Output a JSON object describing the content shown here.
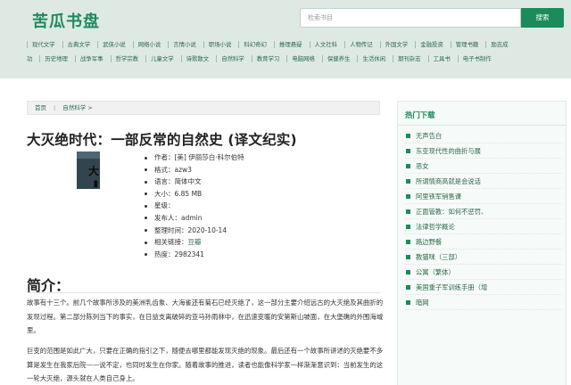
{
  "site": {
    "logo": "苦瓜书盘"
  },
  "search": {
    "placeholder": "检索书目",
    "button": "搜索"
  },
  "nav": {
    "row1": [
      "现代文学",
      "古典文学",
      "武侠小说",
      "网络小说",
      "言情小说",
      "职场小说",
      "科幻奇幻",
      "推理悬疑",
      "人文社科",
      "人物传记",
      "外国文学",
      "金融投资",
      "管理书籍",
      "励志成"
    ],
    "row2": [
      "功",
      "历史地理",
      "战争军事",
      "哲学宗教",
      "儿童文学",
      "诗歌散文",
      "自然科学",
      "教育学习",
      "电脑网络",
      "保健养生",
      "生活休闲",
      "期刊杂志",
      "工具书",
      "电子书制作"
    ]
  },
  "breadcrumb": {
    "home": "首页",
    "category": "自然科学",
    "separator": ">"
  },
  "book": {
    "title": "大灭绝时代：一部反常的自然史 (译文纪实)",
    "cover_colors": {
      "bg": "#32454f"
    },
    "cover_text": "大",
    "meta": [
      {
        "label": "作者：",
        "value": "[美] 伊丽莎白·科尔伯特"
      },
      {
        "label": "格式：",
        "value": "azw3"
      },
      {
        "label": "语言：",
        "value": "简体中文"
      },
      {
        "label": "大小：",
        "value": "6.85 MB"
      },
      {
        "label": "星级：",
        "value": ""
      },
      {
        "label": "发布人：",
        "value": "admin"
      },
      {
        "label": "整理时间：",
        "value": "2020-10-14"
      },
      {
        "label": "相关链接：",
        "value": "豆瓣"
      },
      {
        "label": "热度：",
        "value": "2982341"
      }
    ]
  },
  "intro": {
    "heading": "简介：",
    "p1": "故事有十三个。前几个故事所涉及的美洲乳齿象、大海雀还有菊石已经灭绝了，这一部分主要介绍远古的大灭绝及其曲折的发现过程。第二部分陈列当下的事实，在日益支离破碎的亚马孙雨林中，在迅速变暖的安第斯山坡面，在大堡礁的外围海域里。",
    "p2": "巨变的范围是如此广大，只要在正确的指引之下，随便去哪里都能发现灭绝的现象。最后还有一个故事所讲述的灭绝要不多算是发生在我家后院——说不定，也同时发生在你家。随着故事的推进，读者也能像科学家一样渐渐意识到：当前发生的这一轮大灭绝，源头就在人类自己身上。"
  },
  "sidebar": {
    "title": "热门下载",
    "items": [
      "无声告白",
      "东亚现代性的曲折与展",
      "恶女",
      "所谓情商高就是会说话",
      "阿里铁军销售课",
      "正面管教：如何不惩罚、",
      "法律哲学概论",
      "路边野餐",
      "教猫咪（三部）",
      "公寓（繁体）",
      "美国重子军训练手册（增",
      "暗网"
    ]
  }
}
